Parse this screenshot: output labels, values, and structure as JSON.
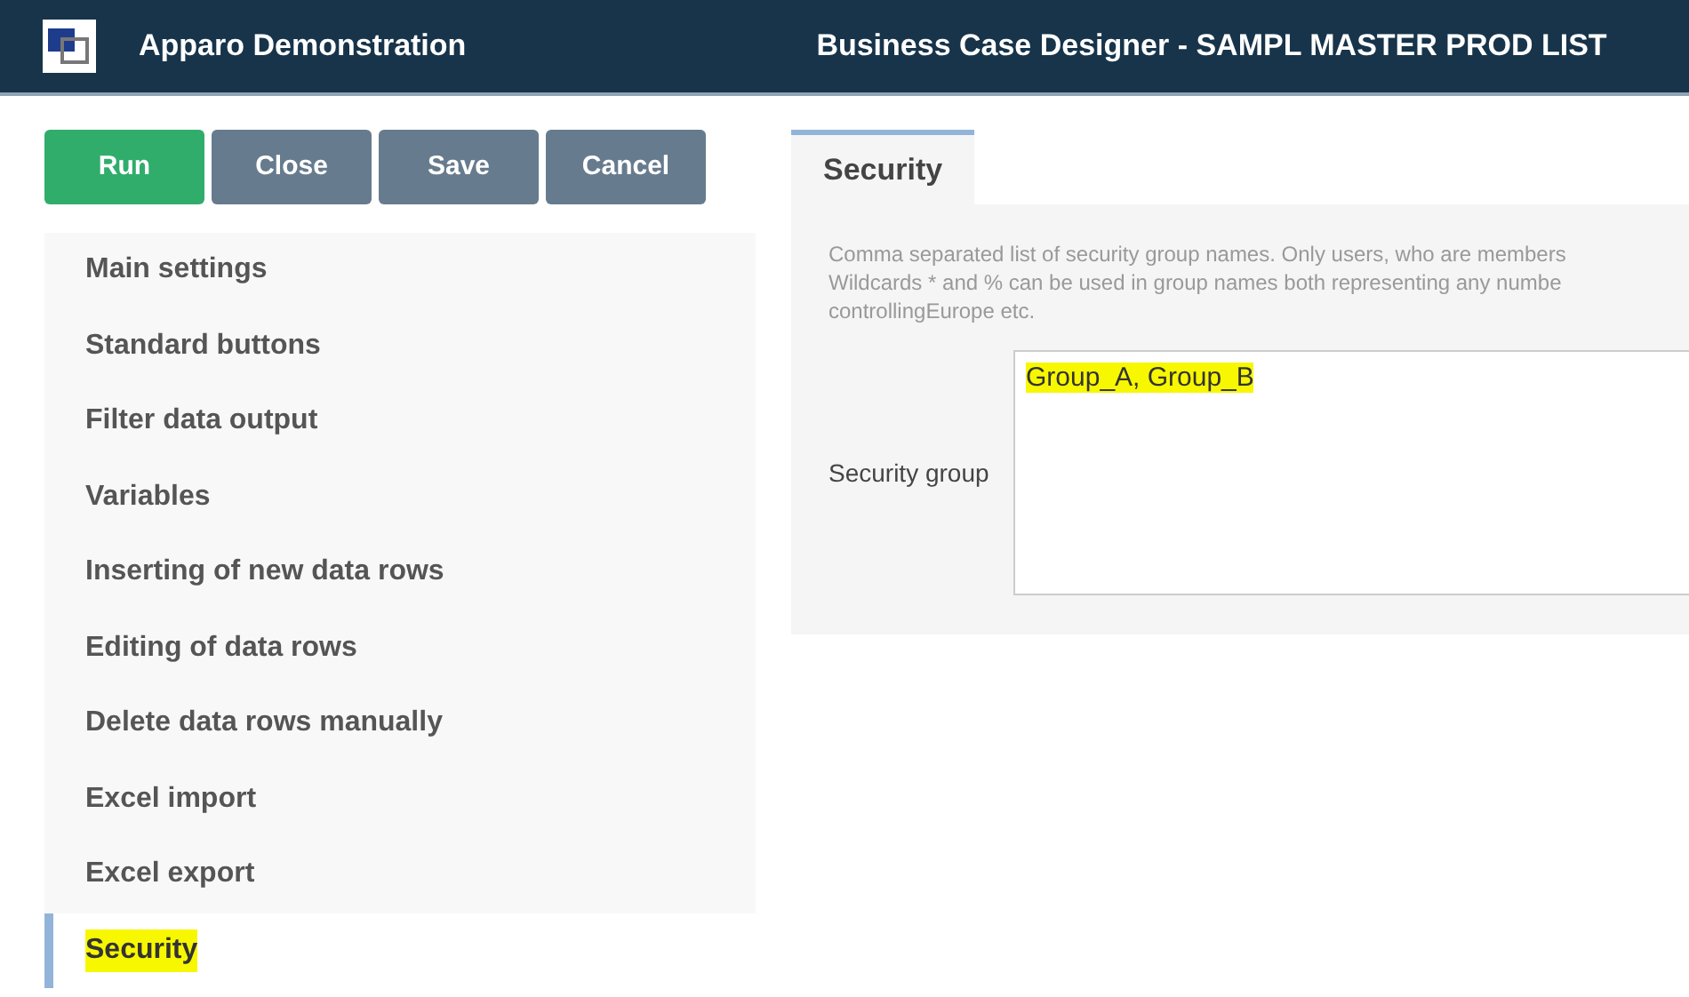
{
  "header": {
    "app_title": "Apparo Demonstration",
    "page_title": "Business Case Designer - SAMPL MASTER PROD LIST"
  },
  "buttons": [
    {
      "label": "Run",
      "kind": "primary"
    },
    {
      "label": "Close",
      "kind": "secondary"
    },
    {
      "label": "Save",
      "kind": "secondary"
    },
    {
      "label": "Cancel",
      "kind": "secondary"
    }
  ],
  "sidebar": {
    "items": [
      {
        "label": "Main settings",
        "selected": false,
        "highlighted": false
      },
      {
        "label": "Standard buttons",
        "selected": false,
        "highlighted": false
      },
      {
        "label": "Filter data output",
        "selected": false,
        "highlighted": false
      },
      {
        "label": "Variables",
        "selected": false,
        "highlighted": false
      },
      {
        "label": "Inserting of new data rows",
        "selected": false,
        "highlighted": false
      },
      {
        "label": "Editing of data rows",
        "selected": false,
        "highlighted": false
      },
      {
        "label": "Delete data rows manually",
        "selected": false,
        "highlighted": false
      },
      {
        "label": "Excel import",
        "selected": false,
        "highlighted": false
      },
      {
        "label": "Excel export",
        "selected": false,
        "highlighted": false
      },
      {
        "label": "Security",
        "selected": true,
        "highlighted": true
      }
    ]
  },
  "tabs": [
    {
      "label": "Security",
      "selected": true
    }
  ],
  "panel": {
    "description_lines": [
      "Comma separated list of security group names. Only users, who are members",
      "Wildcards * and % can be used in group names both representing any numbe",
      "controllingEurope etc."
    ],
    "field": {
      "label": "Security group",
      "value": "Group_A, Group_B",
      "highlighted": true
    }
  }
}
